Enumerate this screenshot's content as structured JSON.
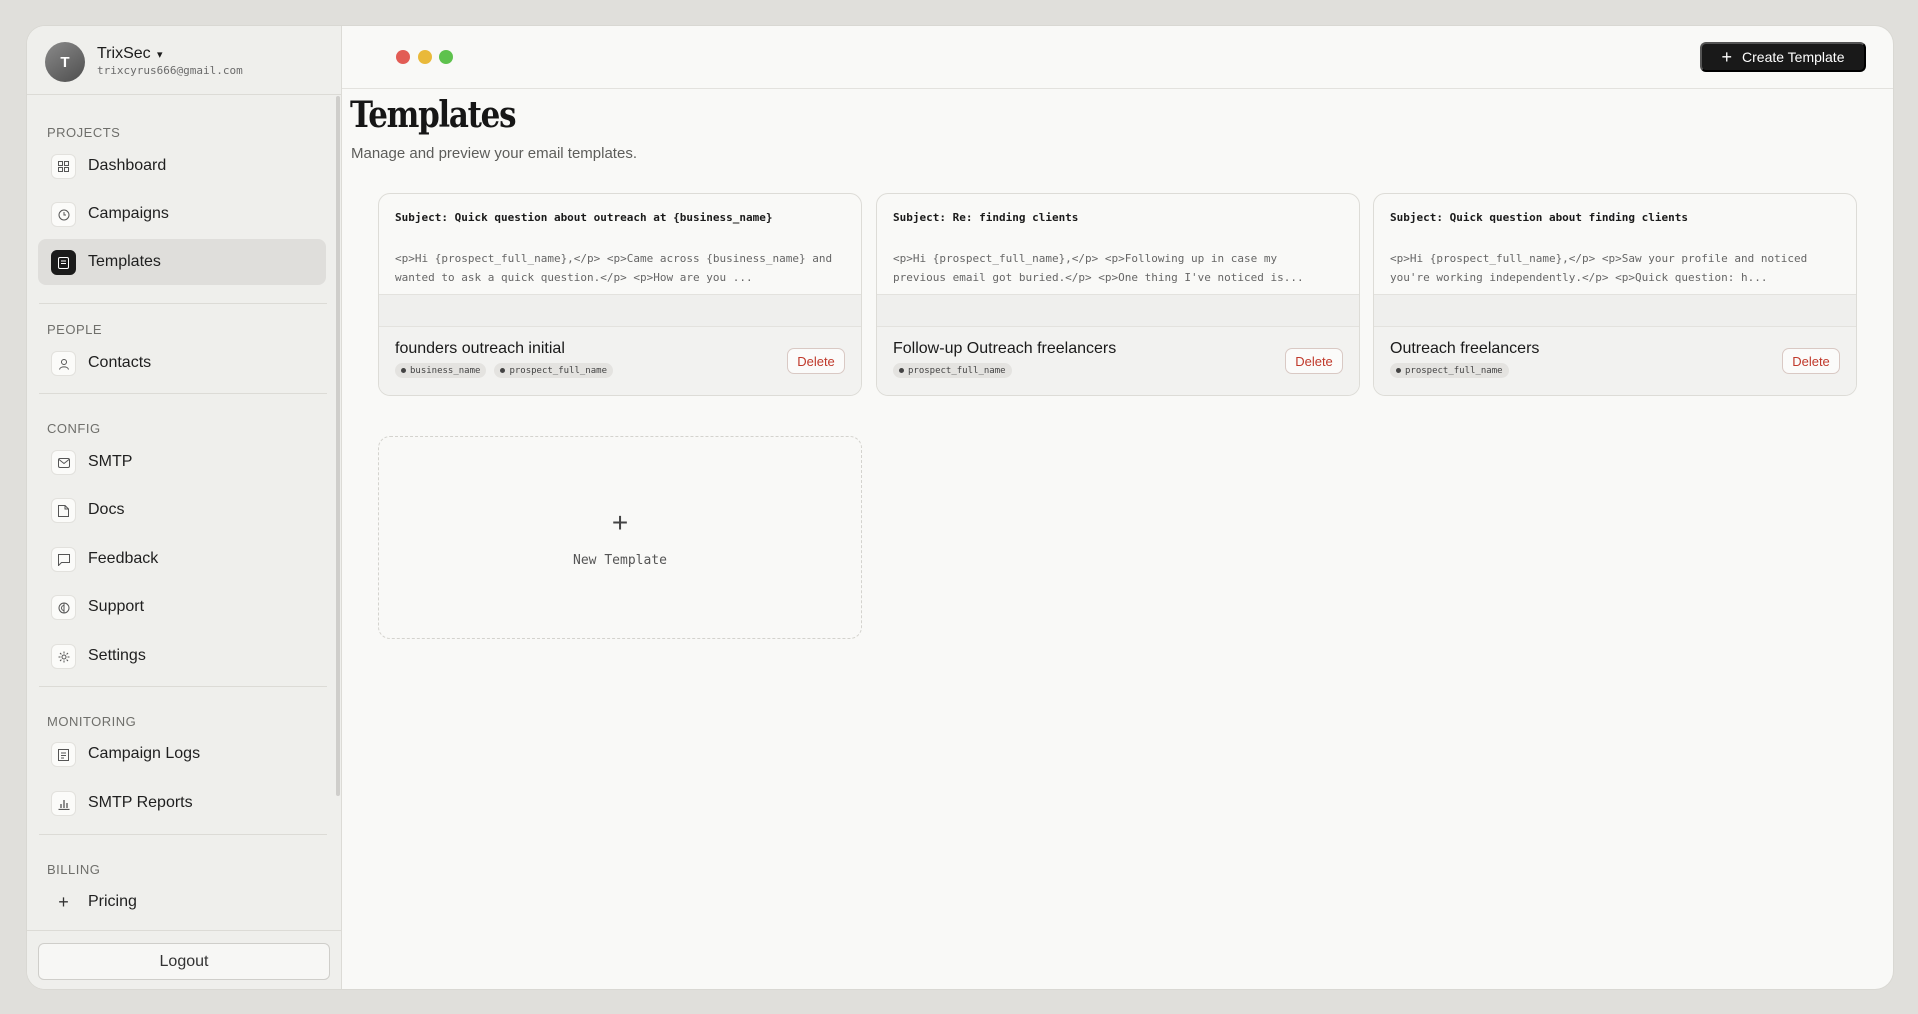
{
  "account": {
    "initial": "T",
    "name": "TrixSec",
    "caret": "▾",
    "email": "trixcyrus666@gmail.com"
  },
  "sidebar": {
    "sections": [
      {
        "label": "PROJECTS"
      },
      {
        "label": "PEOPLE"
      },
      {
        "label": "CONFIG"
      },
      {
        "label": "MONITORING"
      },
      {
        "label": "BILLING"
      }
    ],
    "items": [
      {
        "label": "Dashboard",
        "icon": "grid-icon"
      },
      {
        "label": "Campaigns",
        "icon": "clock-icon"
      },
      {
        "label": "Templates",
        "icon": "document-icon",
        "active": true
      },
      {
        "label": "Contacts",
        "icon": "user-icon"
      },
      {
        "label": "SMTP",
        "icon": "mail-icon"
      },
      {
        "label": "Docs",
        "icon": "file-icon"
      },
      {
        "label": "Feedback",
        "icon": "message-icon"
      },
      {
        "label": "Support",
        "icon": "support-icon"
      },
      {
        "label": "Settings",
        "icon": "gear-icon"
      },
      {
        "label": "Campaign Logs",
        "icon": "log-icon"
      },
      {
        "label": "SMTP Reports",
        "icon": "bar-chart-icon"
      },
      {
        "label": "Pricing",
        "icon": "plus-icon"
      }
    ],
    "logout_label": "Logout"
  },
  "window_controls": {
    "close_color": "#e25c55",
    "minimize_color": "#e9b93a",
    "maximize_color": "#5ec24d"
  },
  "header": {
    "create_label": "Create Template",
    "create_icon": "plus-icon"
  },
  "page": {
    "title": "Templates",
    "subtitle": "Manage and preview your email templates."
  },
  "templates": [
    {
      "subject": "Subject: Quick question about outreach at {business_name}",
      "body_line1": "<p>Hi {prospect_full_name},</p> <p>Came across {business_name} and",
      "body_line2": "wanted to ask a quick question.</p> <p>How are you ...",
      "name": "founders outreach initial",
      "tags": [
        "business_name",
        "prospect_full_name"
      ],
      "delete_label": "Delete"
    },
    {
      "subject": "Subject: Re: finding clients",
      "body_line1": "<p>Hi {prospect_full_name},</p> <p>Following up in case my",
      "body_line2": "previous email got buried.</p> <p>One thing I've noticed is...",
      "name": "Follow-up Outreach freelancers",
      "tags": [
        "prospect_full_name"
      ],
      "delete_label": "Delete"
    },
    {
      "subject": "Subject: Quick question about finding clients",
      "body_line1": "<p>Hi {prospect_full_name},</p> <p>Saw your profile and noticed",
      "body_line2": "you're working independently.</p> <p>Quick question: h...",
      "name": "Outreach freelancers",
      "tags": [
        "prospect_full_name"
      ],
      "delete_label": "Delete"
    }
  ],
  "new_template": {
    "icon": "+",
    "label": "New Template"
  }
}
